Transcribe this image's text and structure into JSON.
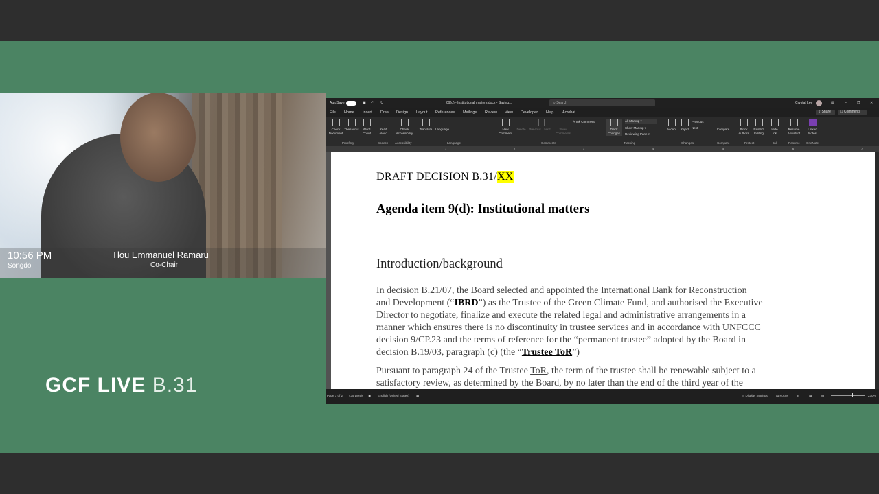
{
  "video": {
    "time": "10:56 PM",
    "location": "Songdo",
    "participant_name": "Tlou Emmanuel Ramaru",
    "participant_role": "Co-Chair"
  },
  "brand": {
    "bold": "GCF LIVE",
    "light": "B.31"
  },
  "word": {
    "autosave_label": "AutoSave",
    "doc_title": "09(d) - Institutional matters.docx - Saving...",
    "search_placeholder": "Search",
    "user_name": "Crystal Lee",
    "menus": [
      "File",
      "Home",
      "Insert",
      "Draw",
      "Design",
      "Layout",
      "References",
      "Mailings",
      "Review",
      "View",
      "Developer",
      "Help",
      "Acrobat"
    ],
    "share_label": "Share",
    "comments_label": "Comments",
    "ribbon": {
      "check_document": "Check Document",
      "thesaurus": "Thesaurus",
      "word_count": "Word Count",
      "read_aloud": "Read Aloud",
      "check_accessibility": "Check Accessibility",
      "translate": "Translate",
      "language": "Language",
      "new_comment": "New Comment",
      "delete": "Delete",
      "previous": "Previous",
      "next": "Next",
      "show_comments": "Show Comments",
      "ink_comment": "Ink Comment",
      "track_changes": "Track Changes",
      "all_markup": "All Markup",
      "show_markup": "Show Markup",
      "reviewing_pane": "Reviewing Pane",
      "accept": "Accept",
      "reject": "Reject",
      "prev_change": "Previous",
      "next_change": "Next",
      "compare": "Compare",
      "block_authors": "Block Authors",
      "restrict_editing": "Restrict Editing",
      "hide_ink": "Hide Ink",
      "resume_assistant": "Resume Assistant",
      "linked_notes": "Linked Notes"
    },
    "groups": [
      "Proofing",
      "Speech",
      "Accessibility",
      "Language",
      "Comments",
      "Tracking",
      "Changes",
      "Compare",
      "Protect",
      "Ink",
      "Resume",
      "OneNote"
    ],
    "status": {
      "page": "Page 1 of 2",
      "words": "435 words",
      "language": "English (United States)",
      "display_settings": "Display Settings",
      "focus": "Focus",
      "zoom": "230%"
    }
  },
  "document": {
    "decision_prefix": "DRAFT DECISION B.31/",
    "decision_highlight": "XX",
    "agenda": "Agenda item 9(d):  Institutional matters",
    "section_heading": "Introduction/background",
    "para1_lines": [
      "In decision B.21/07, the Board  selected and appointed the International Bank for Reconstruction",
      "and Development (“",
      "IBRD",
      "”) as the Trustee of the Green Climate Fund, and authorised the Executive",
      "Director to negotiate, finalize and execute the related legal and administrative arrangements in a",
      "manner which ensures there is no discontinuity in trustee services and in accordance with UNFCCC",
      "decision 9/CP.23 and the terms of reference for the “permanent trustee” adopted by the Board in",
      "decision B.19/03, paragraph (c) (the “",
      "Trustee ToR",
      "”)"
    ],
    "para2_lines": [
      "Pursuant to paragraph 24 of the Trustee ",
      "ToR",
      ", the term of the trustee shall be renewable subject to a",
      "satisfactory review, as determined by the Board, by no later than the end of the third year of the"
    ]
  }
}
